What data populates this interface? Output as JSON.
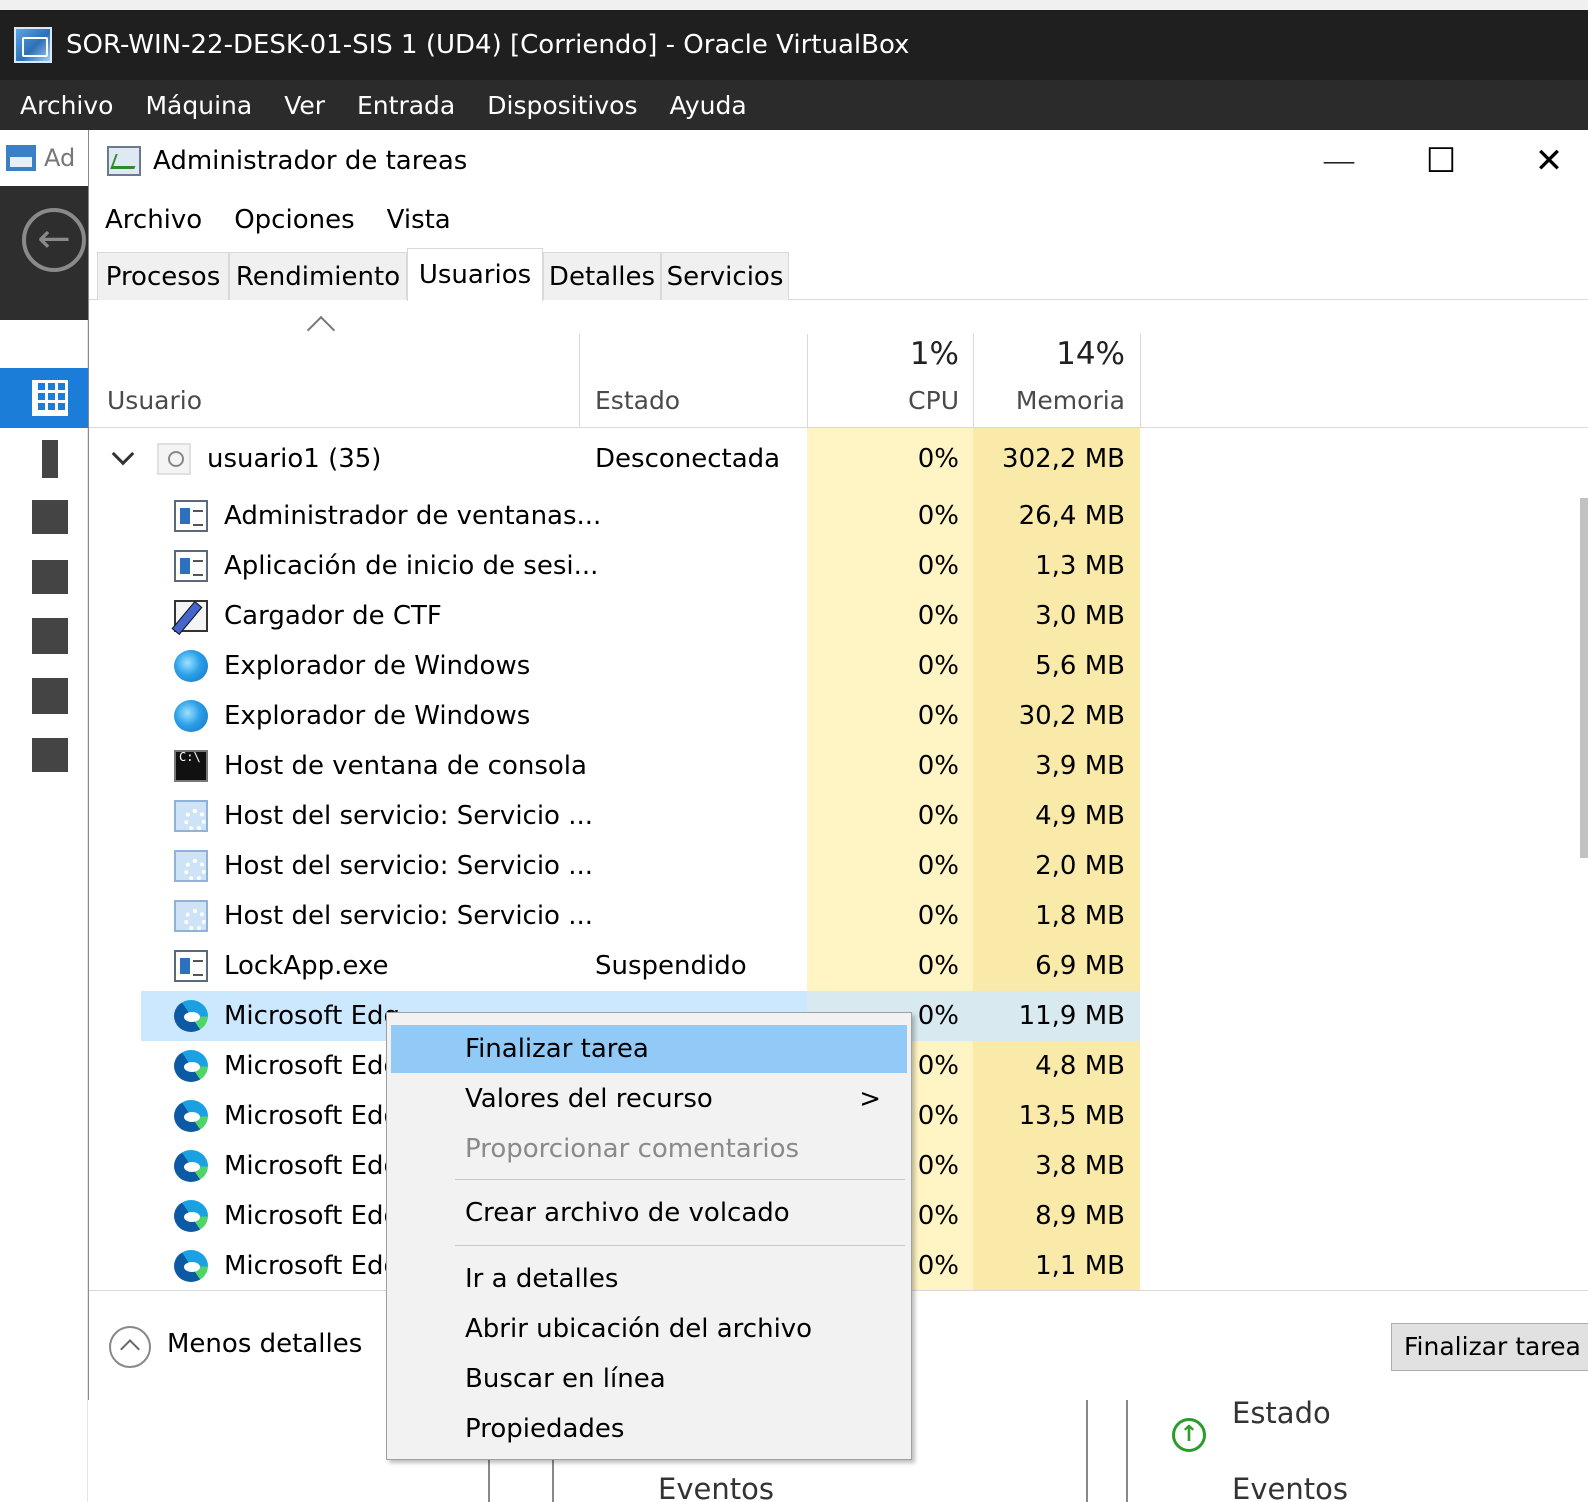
{
  "vbox": {
    "title": "SOR-WIN-22-DESK-01-SIS 1 (UD4) [Corriendo] - Oracle VirtualBox",
    "menu": [
      "Archivo",
      "Máquina",
      "Ver",
      "Entrada",
      "Dispositivos",
      "Ayuda"
    ]
  },
  "server_manager": {
    "header_partial": "Ad",
    "bottom_labels": {
      "estado": "Estado",
      "eventos_left": "Eventos",
      "eventos_right": "Eventos"
    }
  },
  "task_manager": {
    "title": "Administrador de tareas",
    "window_controls": {
      "minimize": "—",
      "maximize": "☐",
      "close": "✕"
    },
    "menu": [
      "Archivo",
      "Opciones",
      "Vista"
    ],
    "tabs": [
      "Procesos",
      "Rendimiento",
      "Usuarios",
      "Detalles",
      "Servicios"
    ],
    "active_tab": "Usuarios",
    "columns": {
      "usuario": "Usuario",
      "estado": "Estado",
      "cpu_pct": "1%",
      "cpu": "CPU",
      "mem_pct": "14%",
      "mem": "Memoria"
    },
    "user_row": {
      "name": "usuario1 (35)",
      "estado": "Desconectada",
      "cpu": "0%",
      "mem": "302,2 MB"
    },
    "processes": [
      {
        "name": "Administrador de ventanas...",
        "estado": "",
        "cpu": "0%",
        "mem": "26,4 MB",
        "icon": "window-icon"
      },
      {
        "name": "Aplicación de inicio de sesi...",
        "estado": "",
        "cpu": "0%",
        "mem": "1,3 MB",
        "icon": "window-icon"
      },
      {
        "name": "Cargador de CTF",
        "estado": "",
        "cpu": "0%",
        "mem": "3,0 MB",
        "icon": "pen-icon"
      },
      {
        "name": "Explorador de Windows",
        "estado": "",
        "cpu": "0%",
        "mem": "5,6 MB",
        "icon": "globe-icon"
      },
      {
        "name": "Explorador de Windows",
        "estado": "",
        "cpu": "0%",
        "mem": "30,2 MB",
        "icon": "globe-icon"
      },
      {
        "name": "Host de ventana de consola",
        "estado": "",
        "cpu": "0%",
        "mem": "3,9 MB",
        "icon": "console-icon"
      },
      {
        "name": "Host del servicio: Servicio ...",
        "estado": "",
        "cpu": "0%",
        "mem": "4,9 MB",
        "icon": "gear-icon"
      },
      {
        "name": "Host del servicio: Servicio ...",
        "estado": "",
        "cpu": "0%",
        "mem": "2,0 MB",
        "icon": "gear-icon"
      },
      {
        "name": "Host del servicio: Servicio ...",
        "estado": "",
        "cpu": "0%",
        "mem": "1,8 MB",
        "icon": "gear-icon"
      },
      {
        "name": "LockApp.exe",
        "estado": "Suspendido",
        "cpu": "0%",
        "mem": "6,9 MB",
        "icon": "window-icon"
      },
      {
        "name": "Microsoft Edg",
        "estado": "",
        "cpu": "0%",
        "mem": "11,9 MB",
        "icon": "edge-icon",
        "selected": true
      },
      {
        "name": "Microsoft Edg",
        "estado": "",
        "cpu": "0%",
        "mem": "4,8 MB",
        "icon": "edge-icon"
      },
      {
        "name": "Microsoft Edg",
        "estado": "",
        "cpu": "0%",
        "mem": "13,5 MB",
        "icon": "edge-icon"
      },
      {
        "name": "Microsoft Edg",
        "estado": "",
        "cpu": "0%",
        "mem": "3,8 MB",
        "icon": "edge-icon"
      },
      {
        "name": "Microsoft Edg",
        "estado": "",
        "cpu": "0%",
        "mem": "8,9 MB",
        "icon": "edge-icon"
      },
      {
        "name": "Microsoft Edg",
        "estado": "",
        "cpu": "0%",
        "mem": "1,1 MB",
        "icon": "edge-icon"
      }
    ],
    "footer": {
      "less_details": "Menos detalles",
      "end_task": "Finalizar tarea"
    }
  },
  "context_menu": {
    "items": [
      {
        "label": "Finalizar tarea",
        "highlighted": true
      },
      {
        "label": "Valores del recurso",
        "submenu_arrow": ">"
      },
      {
        "label": "Proporcionar comentarios",
        "disabled": true
      },
      {
        "label": "Crear archivo de volcado"
      },
      {
        "label": "Ir a detalles"
      },
      {
        "label": "Abrir ubicación del archivo"
      },
      {
        "label": "Buscar en línea"
      },
      {
        "label": "Propiedades"
      }
    ]
  },
  "colors": {
    "selection": "#cce8ff",
    "menu_highlight": "#91c9f7",
    "heat_cpu": "#fff4c4",
    "heat_mem": "#f9eaa9",
    "rail_active": "#1c7dd8"
  }
}
